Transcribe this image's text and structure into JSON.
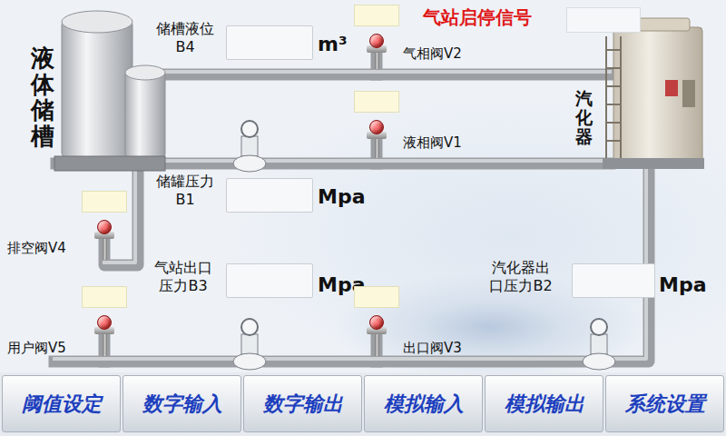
{
  "signal": {
    "label": "气站启停信号",
    "value": ""
  },
  "tank": {
    "label": "液体储槽"
  },
  "vaporizer": {
    "label": "汽化器"
  },
  "readings": [
    {
      "lines": [
        "储槽液位",
        "B4"
      ],
      "value": "",
      "unit": "m³"
    },
    {
      "lines": [
        "储罐压力",
        "B1"
      ],
      "value": "",
      "unit": "Mpa"
    },
    {
      "lines": [
        "气站出口",
        "压力B3"
      ],
      "value": "",
      "unit": "Mpa"
    },
    {
      "lines": [
        "汽化器出",
        "口压力B2"
      ],
      "value": "",
      "unit": "Mpa"
    }
  ],
  "valves": [
    {
      "label": "气相阀V2",
      "open": false,
      "status": ""
    },
    {
      "label": "液相阀V1",
      "open": false,
      "status": ""
    },
    {
      "label": "排空阀V4",
      "open": false,
      "status": ""
    },
    {
      "label": "用户阀V5",
      "open": false,
      "status": ""
    },
    {
      "label": "出口阀V3",
      "open": false,
      "status": ""
    }
  ],
  "nav": [
    {
      "label": "阈值设定",
      "selected": false
    },
    {
      "label": "数字输入",
      "selected": false
    },
    {
      "label": "数字输出",
      "selected": false
    },
    {
      "label": "模拟输入",
      "selected": false
    },
    {
      "label": "模拟输出",
      "selected": false
    },
    {
      "label": "系统设置",
      "selected": false
    }
  ]
}
